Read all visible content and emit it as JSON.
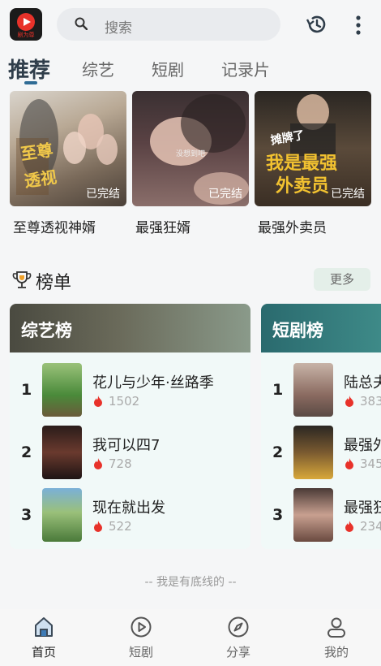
{
  "app": {
    "logo_text": "剧为尊"
  },
  "search": {
    "placeholder": "搜索"
  },
  "tabs": [
    {
      "label": "推荐",
      "active": true
    },
    {
      "label": "综艺"
    },
    {
      "label": "短剧"
    },
    {
      "label": "记录片"
    }
  ],
  "featured": [
    {
      "title": "至尊透视神婿",
      "status": "已完结",
      "poster_text": ""
    },
    {
      "title": "最强狂婿",
      "status": "已完结",
      "poster_text": "没想到吧"
    },
    {
      "title": "最强外卖员",
      "status": "已完结",
      "poster_text": ""
    }
  ],
  "ranking": {
    "title": "榜单",
    "more_label": "更多",
    "boards": [
      {
        "name": "综艺榜",
        "items": [
          {
            "rank": "1",
            "title": "花儿与少年·丝路季",
            "count": "1502"
          },
          {
            "rank": "2",
            "title": "我可以四7",
            "count": "728"
          },
          {
            "rank": "3",
            "title": "现在就出发",
            "count": "522"
          }
        ]
      },
      {
        "name": "短剧榜",
        "items": [
          {
            "rank": "1",
            "title": "陆总夫",
            "count": "383"
          },
          {
            "rank": "2",
            "title": "最强外",
            "count": "345"
          },
          {
            "rank": "3",
            "title": "最强狂",
            "count": "234"
          }
        ]
      }
    ]
  },
  "footer_note": "-- 我是有底线的 --",
  "nav": [
    {
      "label": "首页",
      "icon": "home-icon",
      "active": true
    },
    {
      "label": "短剧",
      "icon": "play-circle-icon"
    },
    {
      "label": "分享",
      "icon": "compass-icon"
    },
    {
      "label": "我的",
      "icon": "user-icon"
    }
  ],
  "colors": {
    "accent": "#2f6c95",
    "fire": "#e8322a",
    "variety_head": "#4a4f45",
    "drama_head": "#2e6f73"
  }
}
